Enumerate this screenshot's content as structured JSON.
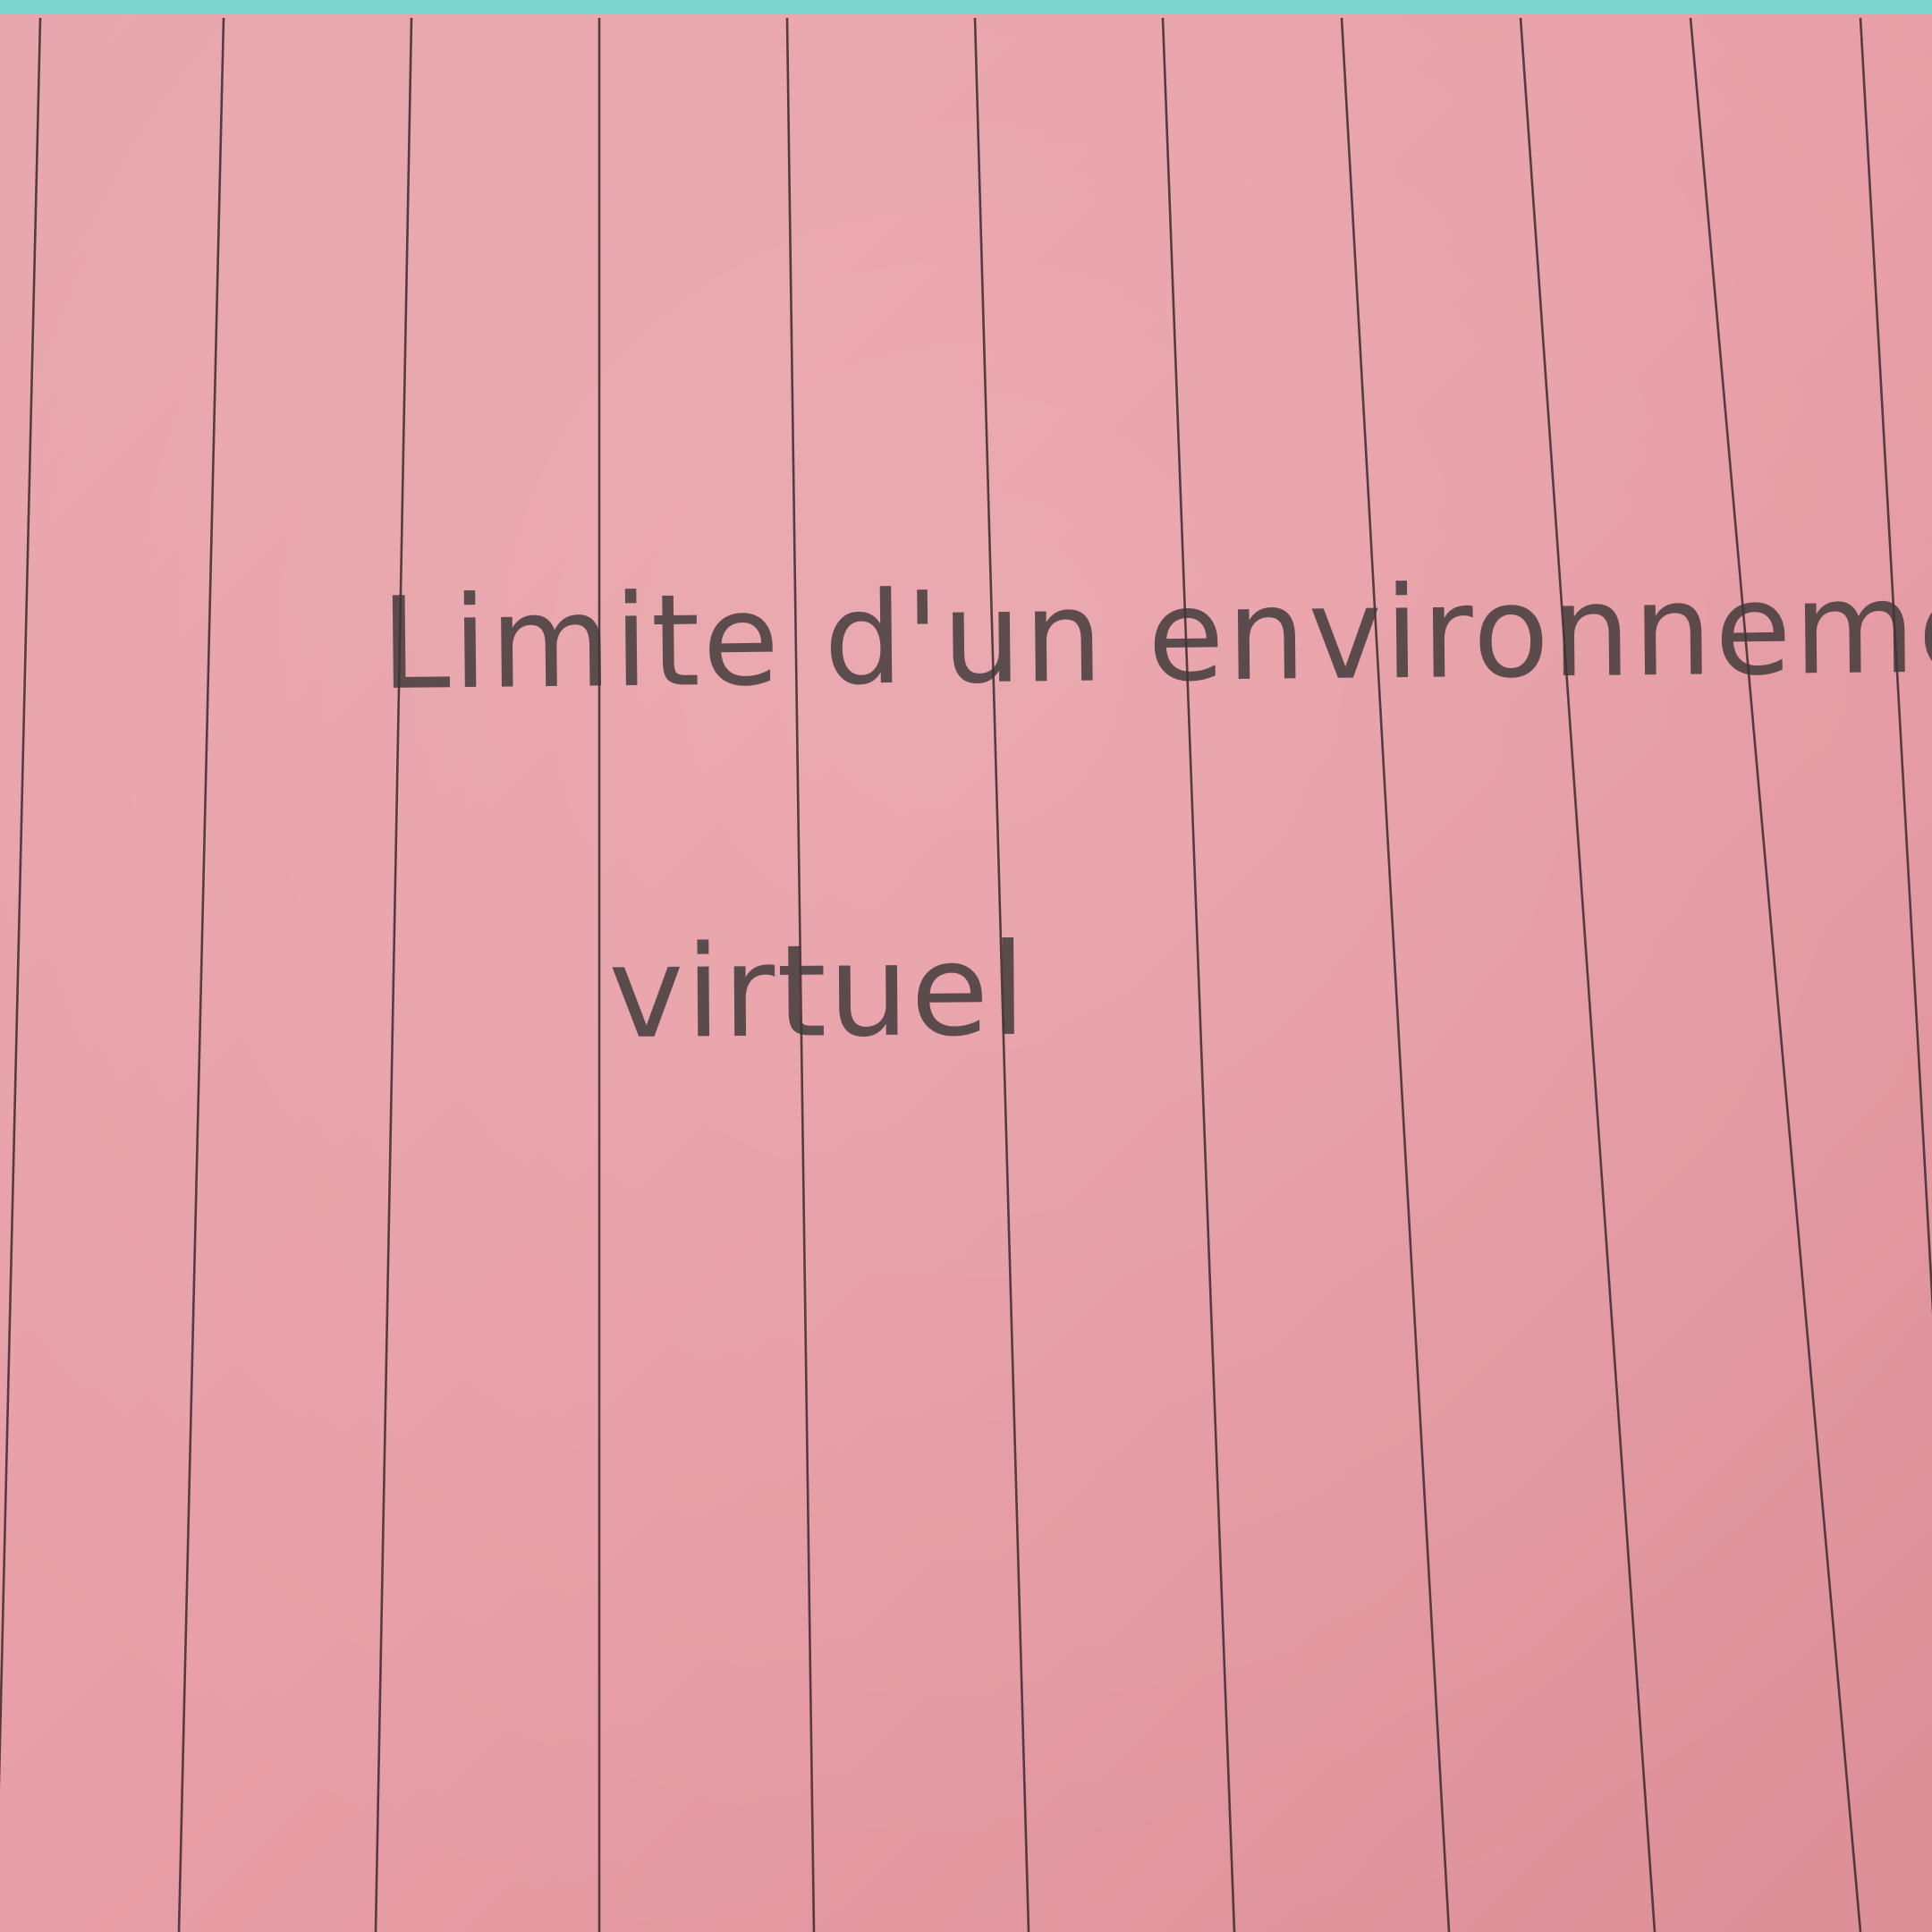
{
  "paper": {
    "color": "#e79aa2",
    "rule_color": "#3a2a2e",
    "top_edge_color": "#7fd6cf"
  },
  "note": {
    "line1": "Limite d'un environnement",
    "line2": "virtuel"
  }
}
